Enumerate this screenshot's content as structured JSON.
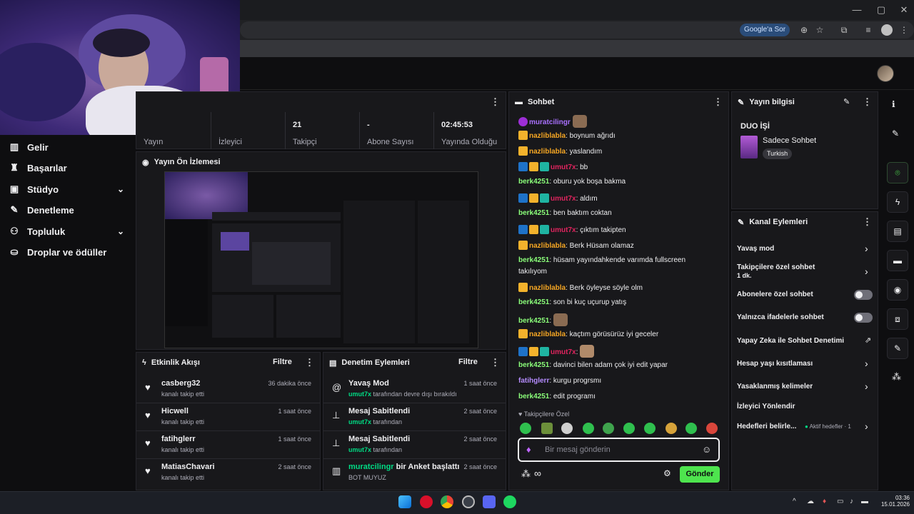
{
  "browser": {
    "google_sor": "Google'a Sor",
    "window": {
      "minimize": "—",
      "maximize": "▢",
      "close": "✕"
    }
  },
  "webcam": {
    "icon": "webcam-person"
  },
  "sidebar": {
    "items": [
      {
        "label": "Gelir",
        "icon": "chart-icon"
      },
      {
        "label": "Başarılar",
        "icon": "trophy-icon"
      },
      {
        "label": "Stüdyo",
        "icon": "studio-icon",
        "expandable": true
      },
      {
        "label": "Denetleme",
        "icon": "wrench-icon"
      },
      {
        "label": "Topluluk",
        "icon": "community-icon",
        "expandable": true
      },
      {
        "label": "Droplar ve ödüller",
        "icon": "drops-icon"
      }
    ]
  },
  "stats": [
    {
      "value": "",
      "label": "Yayın"
    },
    {
      "value": "",
      "label": "İzleyici"
    },
    {
      "value": "21",
      "label": "Takipçi"
    },
    {
      "value": "-",
      "label": "Abone Sayısı"
    },
    {
      "value": "02:45:53",
      "label": "Yayında Olduğu"
    }
  ],
  "preview": {
    "title": "Yayın Ön İzlemesi"
  },
  "activity": {
    "title": "Etkinlik Akışı",
    "filter": "Filtre",
    "rows": [
      {
        "name": "casberg32",
        "desc": "kanalı takip etti",
        "time": "36 dakika önce"
      },
      {
        "name": "Hicwell",
        "desc": "kanalı takip etti",
        "time": "1 saat önce"
      },
      {
        "name": "fatihglerr",
        "desc": "kanalı takip etti",
        "time": "1 saat önce"
      },
      {
        "name": "MatiasChavari",
        "desc": "kanalı takip etti",
        "time": "2 saat önce"
      }
    ]
  },
  "moderation": {
    "title": "Denetim Eylemleri",
    "filter": "Filtre",
    "rows": [
      {
        "title": "Yavaş Mod",
        "user": "umut7x",
        "desc": " tarafından devre dışı bırakıldı",
        "time": "1 saat önce",
        "icon": "snail-icon"
      },
      {
        "title": "Mesaj Sabitlendi",
        "user": "umut7x",
        "desc": " tarafından",
        "time": "2 saat önce",
        "icon": "pin-icon"
      },
      {
        "title": "Mesaj Sabitlendi",
        "user": "umut7x",
        "desc": " tarafından",
        "time": "2 saat önce",
        "icon": "pin-icon"
      },
      {
        "title_user": "muratcilingr",
        "title_rest": " bir Anket başlattı",
        "desc": "BOT MUYUZ",
        "time": "2 saat önce",
        "icon": "poll-icon"
      }
    ]
  },
  "chat": {
    "title": "Sohbet",
    "messages": [
      {
        "user": "muratcilingr",
        "text": "",
        "color": "#9146ff"
      },
      {
        "user": "nazliblabla",
        "text": ": boynum ağrıdı",
        "color": "#f5a623"
      },
      {
        "user": "nazliblabla",
        "text": ": yaslandım",
        "color": "#f5a623"
      },
      {
        "user": "umut7x",
        "text": ": bb",
        "color": "#e0245e"
      },
      {
        "user": "berk4251",
        "text": ": oburu yok boşa bakma",
        "color": "#8bff7a"
      },
      {
        "user": "umut7x",
        "text": ": aldım",
        "color": "#e0245e"
      },
      {
        "user": "berk4251",
        "text": ": ben baktım coktan",
        "color": "#8bff7a"
      },
      {
        "user": "umut7x",
        "text": ": çıktım takipten",
        "color": "#e0245e"
      },
      {
        "user": "nazliblabla",
        "text": ": Berk Hüsam olamaz",
        "color": "#f5a623"
      },
      {
        "user": "berk4251",
        "text": ": hüsam yayındahkende varımda fullscreen",
        "color": "#8bff7a"
      },
      {
        "user": "",
        "text": "takılıyom",
        "color": "#efeff1"
      },
      {
        "user": "nazliblabla",
        "text": ": Berk öyleyse söyle olm",
        "color": "#f5a623"
      },
      {
        "user": "berk4251",
        "text": ": son bi kuç uçurup yatış",
        "color": "#8bff7a"
      },
      {
        "user": "berk4251",
        "text": ":",
        "color": "#8bff7a"
      },
      {
        "user": "nazliblabla",
        "text": ": kaçtım görüsürüz iyi geceler",
        "color": "#f5a623"
      },
      {
        "user": "umut7x",
        "text": ":",
        "color": "#e0245e"
      },
      {
        "user": "berk4251",
        "text": ": davinci bilen adam çok iyi edit yapar",
        "color": "#8bff7a"
      },
      {
        "user": "fatihglerr",
        "text": ": kurgu progrsmı",
        "color": "#b58cff"
      },
      {
        "user": "berk4251",
        "text": ": edit programı",
        "color": "#8bff7a"
      }
    ],
    "followers_only": "Takipçilere Özel",
    "placeholder": "Bir mesaj gönderin",
    "send": "Gönder"
  },
  "stream_info": {
    "title": "Yayın bilgisi",
    "stream_title": "DUO İŞİ",
    "category": "Sadece Sohbet",
    "tag": "Turkish"
  },
  "channel_actions": {
    "title": "Kanal Eylemleri",
    "slow_mode": "Yavaş mod",
    "followers_chat": "Takipçilere özel sohbet",
    "followers_duration": "1 dk.",
    "subs_chat": "Abonelere özel sohbet",
    "emote_chat": "Yalnızca ifadelerle sohbet",
    "ai_mod": "Yapay Zeka ile Sohbet Denetimi",
    "age_limits": "Hesap yaşı kısıtlaması",
    "banned_words": "Yasaklanmış kelimeler",
    "redirect": "İzleyici Yönlendir",
    "goals": "Hedefleri belirle...",
    "goals_active": "Aktif hedefler · 1"
  },
  "taskbar": {
    "time": "03:36",
    "date": "15.01.2026"
  }
}
